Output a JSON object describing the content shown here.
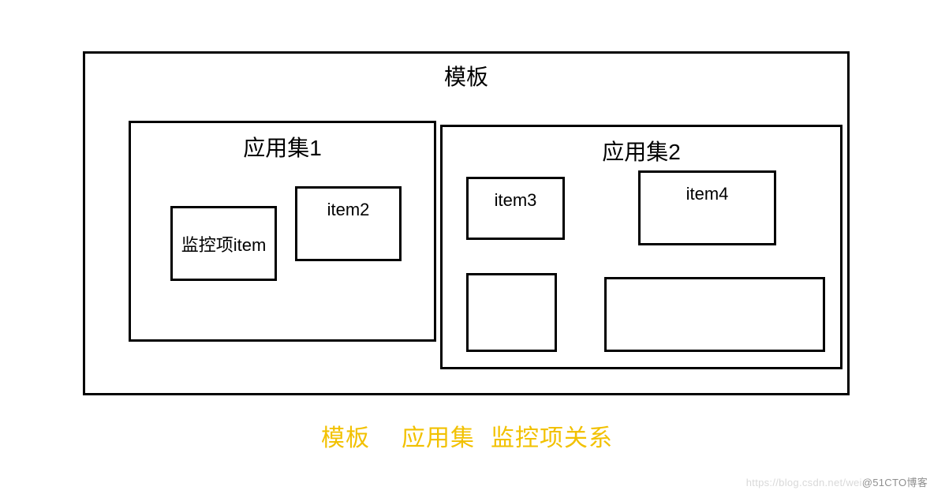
{
  "template": {
    "title": "模板",
    "set1": {
      "title": "应用集1",
      "item1": "监控项item",
      "item2": "item2"
    },
    "set2": {
      "title": "应用集2",
      "item3": "item3",
      "item4": "item4",
      "item5": "",
      "item6": ""
    }
  },
  "caption": {
    "part1": "模板",
    "part2": "应用集",
    "part3": "监控项关系"
  },
  "watermark": {
    "faint": "https://blog.csdn.net/wei",
    "dark": "@51CTO博客"
  }
}
